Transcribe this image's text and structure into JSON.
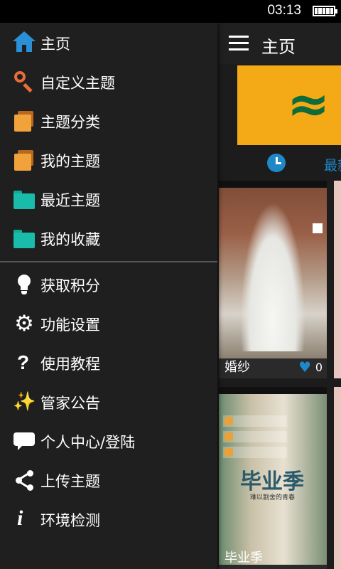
{
  "status_bar": {
    "time": "03:13"
  },
  "app_bar": {
    "title": "主页"
  },
  "tabs": {
    "latest_label": "最新"
  },
  "cards": [
    {
      "caption": "婚纱",
      "likes": "0"
    },
    {
      "caption": "毕业季",
      "image_title": "毕业季",
      "image_subtitle": "难以割舍的青春"
    }
  ],
  "drawer": {
    "items": [
      {
        "label": "主页",
        "icon": "home-icon"
      },
      {
        "label": "自定义主题",
        "icon": "search-icon"
      },
      {
        "label": "主题分类",
        "icon": "stack-icon"
      },
      {
        "label": "我的主题",
        "icon": "stack-icon"
      },
      {
        "label": "最近主题",
        "icon": "folder-icon"
      },
      {
        "label": "我的收藏",
        "icon": "folder-icon"
      },
      {
        "label": "获取积分",
        "icon": "lightbulb-icon"
      },
      {
        "label": "功能设置",
        "icon": "gear-icon"
      },
      {
        "label": "使用教程",
        "icon": "question-icon"
      },
      {
        "label": "管家公告",
        "icon": "magic-wand-icon"
      },
      {
        "label": "个人中心/登陆",
        "icon": "chat-bubble-icon"
      },
      {
        "label": "上传主题",
        "icon": "share-icon"
      },
      {
        "label": "环境检测",
        "icon": "info-icon"
      }
    ]
  },
  "colors": {
    "accent": "#1e88c9",
    "drawer_bg": "#1f1f1f",
    "home_icon": "#2a8fd6",
    "search_icon": "#ea6c3a",
    "stack_icon": "#f2a23a",
    "folder_icon": "#19bcab"
  }
}
